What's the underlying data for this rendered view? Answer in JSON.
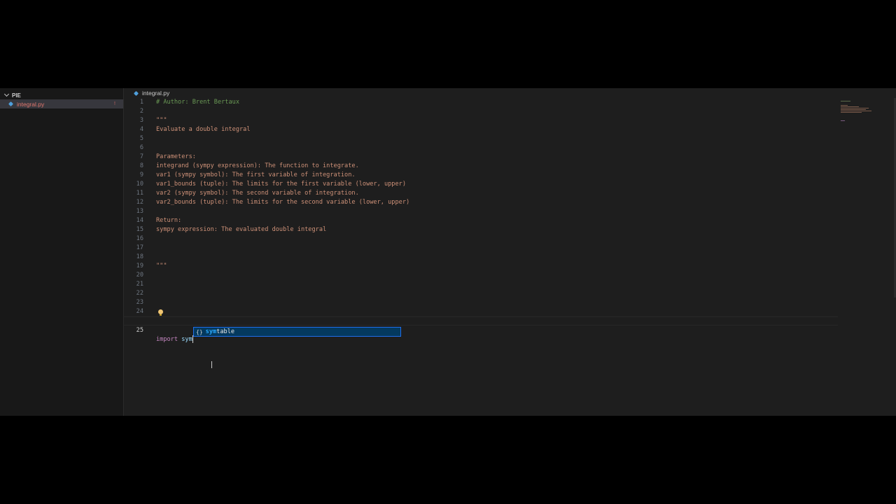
{
  "explorer": {
    "title": "PIE",
    "file": {
      "name": "integral.py",
      "badge": "!"
    }
  },
  "tab": {
    "label": "integral.py"
  },
  "editor": {
    "lines": [
      {
        "n": "1",
        "text": "# Author: Brent Bertaux"
      },
      {
        "n": "2",
        "text": ""
      },
      {
        "n": "3",
        "text": "\"\"\""
      },
      {
        "n": "4",
        "text": "Evaluate a double integral"
      },
      {
        "n": "5",
        "text": ""
      },
      {
        "n": "6",
        "text": ""
      },
      {
        "n": "7",
        "text": "Parameters:"
      },
      {
        "n": "8",
        "text": "integrand (sympy expression): The function to integrate."
      },
      {
        "n": "9",
        "text": "var1 (sympy symbol): The first variable of integration."
      },
      {
        "n": "10",
        "text": "var1_bounds (tuple): The limits for the first variable (lower, upper)"
      },
      {
        "n": "11",
        "text": "var2 (sympy symbol): The second variable of integration."
      },
      {
        "n": "12",
        "text": "var2_bounds (tuple): The limits for the second variable (lower, upper)"
      },
      {
        "n": "13",
        "text": ""
      },
      {
        "n": "14",
        "text": "Return:"
      },
      {
        "n": "15",
        "text": "sympy expression: The evaluated double integral"
      },
      {
        "n": "16",
        "text": ""
      },
      {
        "n": "17",
        "text": ""
      },
      {
        "n": "18",
        "text": ""
      },
      {
        "n": "19",
        "text": "\"\"\""
      },
      {
        "n": "20",
        "text": ""
      },
      {
        "n": "21",
        "text": ""
      },
      {
        "n": "22",
        "text": ""
      },
      {
        "n": "23",
        "text": ""
      },
      {
        "n": "24",
        "text": ""
      }
    ],
    "current_line": {
      "n": "25",
      "keyword": "import",
      "typed": "sym"
    }
  },
  "suggestion": {
    "icon": "{}",
    "match": "sym",
    "rest": "table"
  },
  "colors": {
    "string": "#ce9178",
    "comment": "#6a9955",
    "keyword": "#c586c0",
    "suggest_bg": "#04395e"
  },
  "icons": [
    "chevron-down-icon",
    "python-file-icon",
    "lightbulb-icon",
    "module-icon",
    "text-cursor-icon"
  ]
}
